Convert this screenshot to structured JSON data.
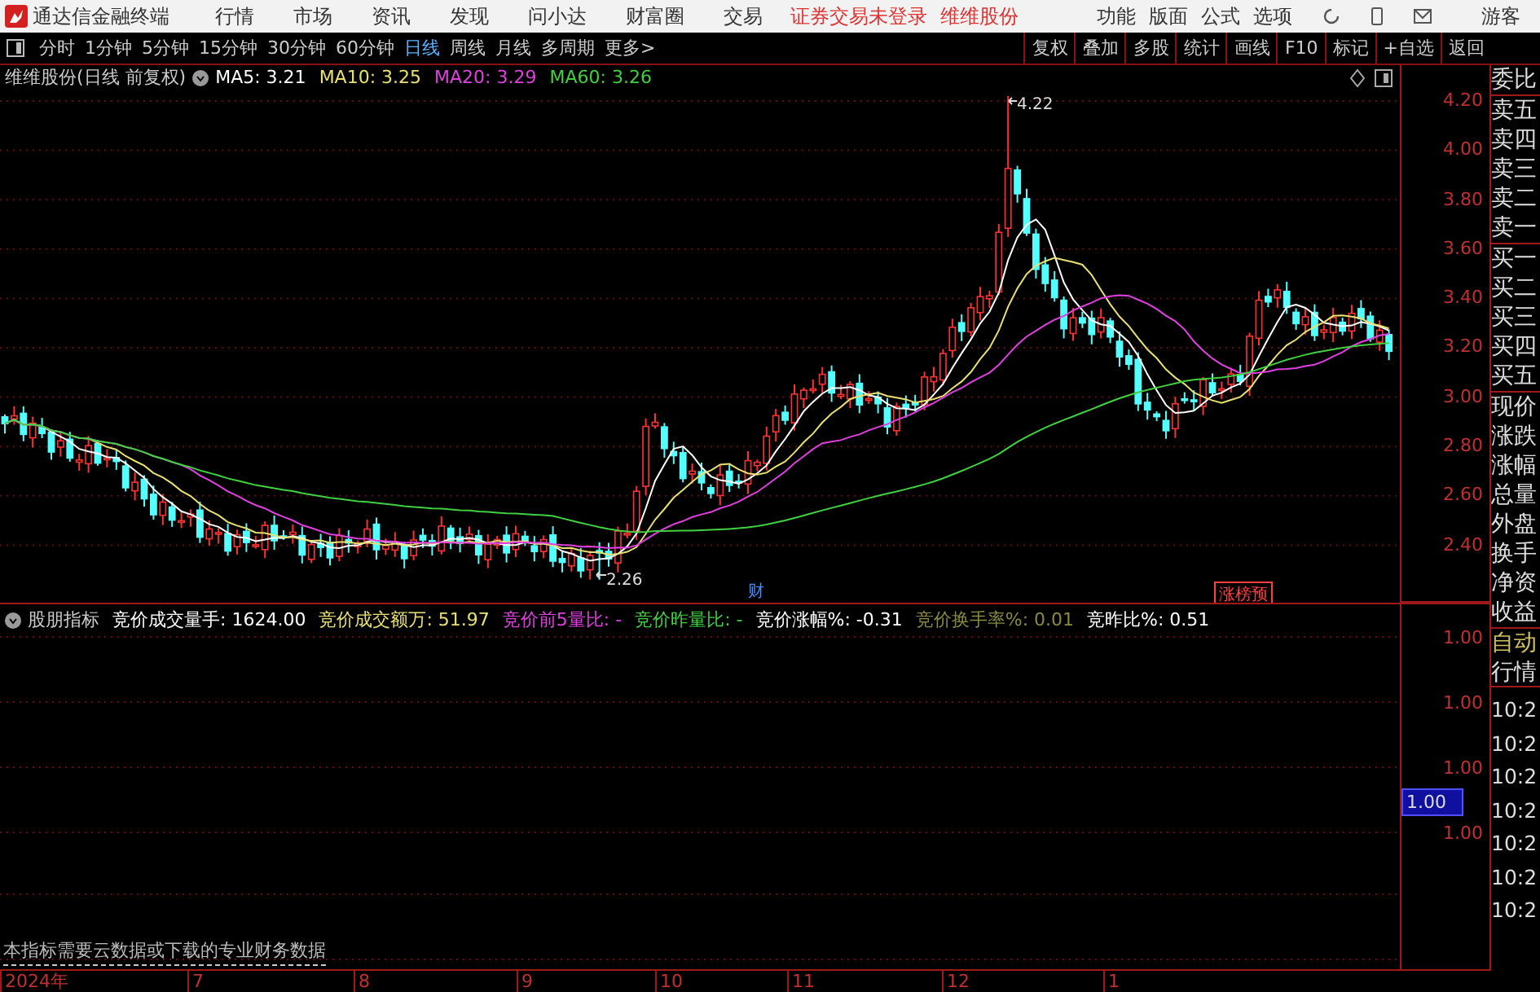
{
  "title_bar": {
    "app_name": "通达信金融终端",
    "menus": [
      "行情",
      "市场",
      "资讯",
      "发现",
      "问小达",
      "财富圈",
      "交易"
    ],
    "login_status": "证券交易未登录",
    "stock_name": "维维股份",
    "tools": [
      "功能",
      "版面",
      "公式",
      "选项"
    ],
    "user": "游客"
  },
  "period_bar": {
    "periods": [
      {
        "label": "分时",
        "selected": false
      },
      {
        "label": "1分钟",
        "selected": false
      },
      {
        "label": "5分钟",
        "selected": false
      },
      {
        "label": "15分钟",
        "selected": false
      },
      {
        "label": "30分钟",
        "selected": false
      },
      {
        "label": "60分钟",
        "selected": false
      },
      {
        "label": "日线",
        "selected": true
      },
      {
        "label": "周线",
        "selected": false
      },
      {
        "label": "月线",
        "selected": false
      },
      {
        "label": "多周期",
        "selected": false
      }
    ],
    "more": "更多>",
    "buttons": [
      "复权",
      "叠加",
      "多股",
      "统计",
      "画线",
      "F10",
      "标记",
      "+自选",
      "返回"
    ]
  },
  "price_chart": {
    "title": "维维股份(日线 前复权)",
    "moving_averages": [
      {
        "label": "MA5: 3.21",
        "color": "#ffffff"
      },
      {
        "label": "MA10: 3.25",
        "color": "#e8e070"
      },
      {
        "label": "MA20: 3.29",
        "color": "#e040e0"
      },
      {
        "label": "MA60: 3.26",
        "color": "#40d040"
      }
    ],
    "price_axis": [
      "4.20",
      "4.00",
      "3.80",
      "3.60",
      "3.40",
      "3.20",
      "3.00",
      "2.80",
      "2.60",
      "2.40"
    ],
    "high_label": "4.22",
    "low_label": "2.26",
    "markers": [
      {
        "kind": "finance",
        "text": "财"
      },
      {
        "kind": "tag",
        "text": "涨榜预"
      }
    ]
  },
  "indicator": {
    "name": "股朋指标",
    "values": [
      {
        "label": "竞价成交量手: 1624.00",
        "color": "#ffffff"
      },
      {
        "label": "竞价成交额万: 51.97",
        "color": "#e8e070"
      },
      {
        "label": "竞价前5量比: -",
        "color": "#e040e0"
      },
      {
        "label": "竞价昨量比: -",
        "color": "#40d040"
      },
      {
        "label": "竞价涨幅%: -0.31",
        "color": "#ffffff"
      },
      {
        "label": "竞价换手率%: 0.01",
        "color": "#8a8a40"
      },
      {
        "label": "竞昨比%: 0.51",
        "color": "#ffffff"
      }
    ],
    "axis": [
      "1.00",
      "1.00",
      "1.00",
      "1.00"
    ],
    "current_value": "1.00",
    "note": "本指标需要云数据或下载的专业财务数据"
  },
  "x_axis": [
    "2024年",
    "7",
    "8",
    "9",
    "10",
    "11",
    "12",
    "1"
  ],
  "quote_panel": {
    "groups": [
      [
        "委比"
      ],
      [
        "卖五",
        "卖四",
        "卖三",
        "卖二",
        "卖一"
      ],
      [
        "买一",
        "买二",
        "买三",
        "买四",
        "买五"
      ],
      [
        "现价",
        "涨跌",
        "涨幅",
        "总量",
        "外盘",
        "换手",
        "净资",
        "收益"
      ]
    ],
    "mode": "自动",
    "tab": "行情",
    "times": [
      "10:2",
      "10:2",
      "10:2",
      "10:2",
      "10:2",
      "10:2",
      "10:2"
    ]
  }
}
